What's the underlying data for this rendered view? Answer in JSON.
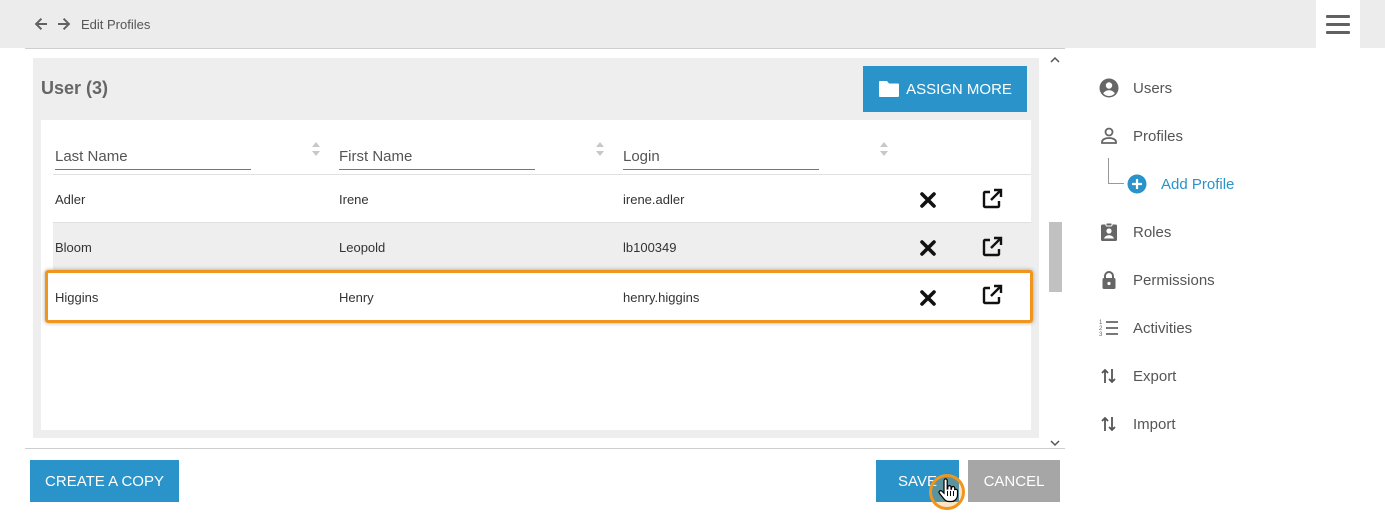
{
  "topbar": {
    "title": "Edit Profiles"
  },
  "panel": {
    "title": "User (3)",
    "assign_more_label": "ASSIGN MORE"
  },
  "table": {
    "columns": [
      "Last Name",
      "First Name",
      "Login"
    ],
    "rows": [
      {
        "last": "Adler",
        "first": "Irene",
        "login": "irene.adler"
      },
      {
        "last": "Bloom",
        "first": "Leopold",
        "login": "lb100349"
      },
      {
        "last": "Higgins",
        "first": "Henry",
        "login": "henry.higgins"
      }
    ]
  },
  "buttons": {
    "create_copy": "CREATE A COPY",
    "save": "SAVE",
    "cancel": "CANCEL"
  },
  "sidebar": {
    "items": [
      {
        "label": "Users",
        "icon": "account-circle-icon"
      },
      {
        "label": "Profiles",
        "icon": "person-outline-icon"
      },
      {
        "label": "Add Profile",
        "icon": "add-circle-icon"
      },
      {
        "label": "Roles",
        "icon": "clipboard-account-icon"
      },
      {
        "label": "Permissions",
        "icon": "lock-icon"
      },
      {
        "label": "Activities",
        "icon": "numbered-list-icon"
      },
      {
        "label": "Export",
        "icon": "swap-vertical-icon"
      },
      {
        "label": "Import",
        "icon": "swap-vertical-icon"
      }
    ]
  },
  "colors": {
    "accent": "#2a93c9",
    "highlight": "#f0961e",
    "cancel": "#a6a6a6"
  }
}
